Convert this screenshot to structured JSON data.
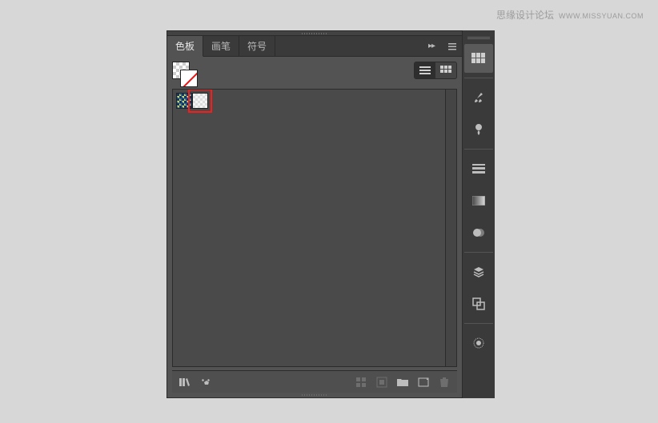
{
  "watermark": {
    "text": "思缘设计论坛",
    "url": "WWW.MISSYUAN.COM"
  },
  "tabs": {
    "swatches": "色板",
    "brushes": "画笔",
    "symbols": "符号"
  },
  "panel_menu_glyph": "▸▸",
  "dock": {
    "grid": "grid-icon",
    "brushes": "brushes-icon",
    "symbols": "symbols-icon",
    "stroke": "stroke-icon",
    "gradient": "gradient-icon",
    "transparency": "transparency-icon",
    "layers": "layers-icon",
    "artboards": "artboards-icon",
    "appearance": "appearance-icon"
  },
  "view": {
    "list": "list-view",
    "thumb": "thumb-view"
  },
  "swatches": [
    {
      "name": "decorative-pattern",
      "class": "pattern-a"
    },
    {
      "name": "checker-pattern",
      "class": "pattern-b"
    }
  ],
  "highlight_index": 1,
  "footer": {
    "library_menu": "swatch-libraries-menu",
    "show_kind": "show-swatch-kinds",
    "options": "swatch-options",
    "new_group": "new-color-group",
    "new_swatch": "new-swatch",
    "folder": "open-folder",
    "delete": "delete-swatch"
  }
}
